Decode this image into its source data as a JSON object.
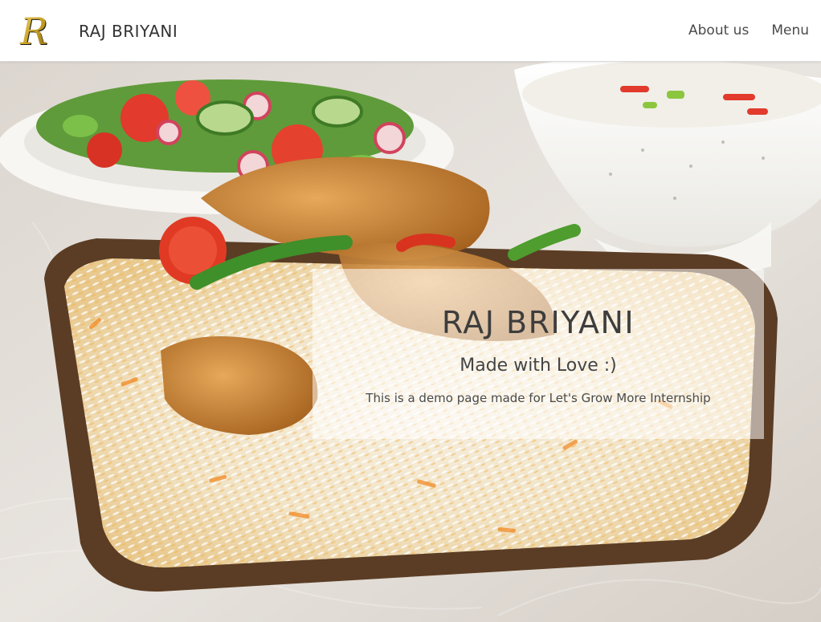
{
  "navbar": {
    "logo_letter": "R",
    "brand": "RAJ BRIYANI",
    "links": [
      {
        "label": "About us"
      },
      {
        "label": "Menu"
      }
    ]
  },
  "hero": {
    "image": "biryani-plate-photo",
    "card": {
      "title": "RAJ BRIYANI",
      "subtitle": "Made with Love :)",
      "description": "This is a demo page made for Let's Grow More Internship"
    }
  },
  "colors": {
    "navbar_bg": "#ffffff",
    "text_dark": "#3d3d3d",
    "logo_gold": "#c9a227"
  }
}
